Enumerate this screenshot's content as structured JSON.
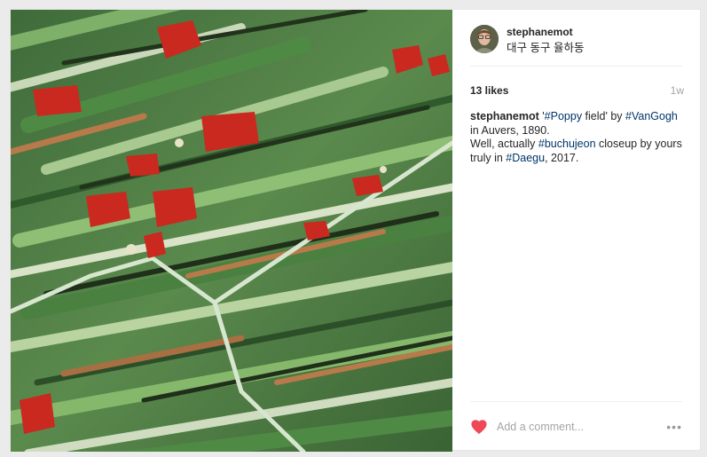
{
  "post": {
    "username": "stephanemot",
    "location": "대구 동구 율하동",
    "likes": "13 likes",
    "age": "1w",
    "caption": {
      "user": "stephanemot",
      "parts": [
        "'",
        "#Poppy",
        " field' by ",
        "#VanGogh",
        " in Auvers, 1890.",
        "Well, actually ",
        "#buchujeon",
        " closeup by yours truly in ",
        "#Daegu",
        ", 2017."
      ]
    },
    "comment_placeholder": "Add a comment...",
    "more_label": "•••"
  },
  "icons": {
    "heart": "heart-icon",
    "more": "more-options-icon"
  },
  "colors": {
    "heart": "#ed4956",
    "hashtag": "#003569",
    "muted": "#a5a5a5"
  }
}
